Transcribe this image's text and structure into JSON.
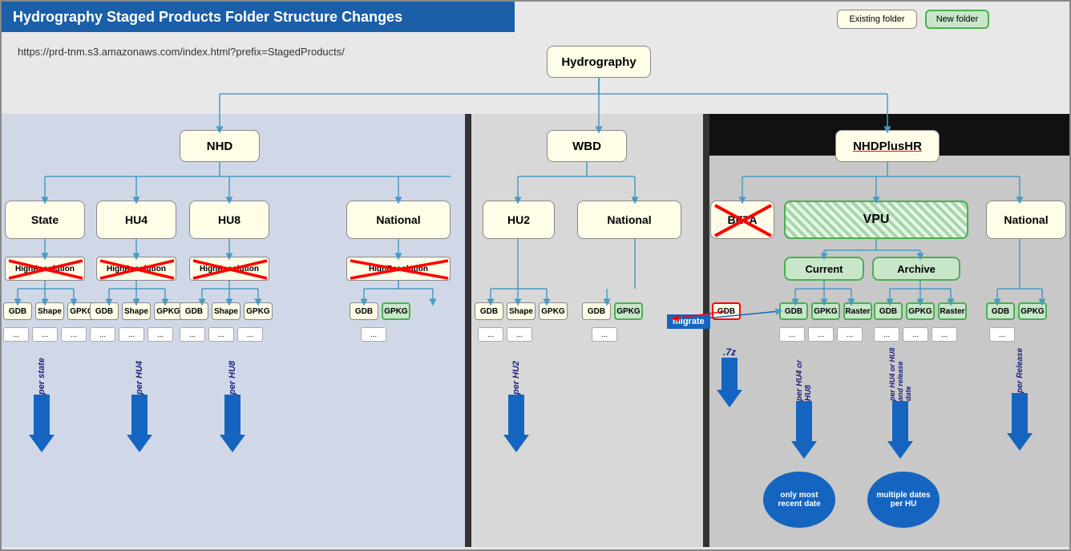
{
  "title": "Hydrography Staged Products Folder Structure Changes",
  "url": "https://prd-tnm.s3.amazonaws.com/index.html?prefix=StagedProducts/",
  "legend": {
    "existing": "Existing folder",
    "new": "New folder"
  },
  "nodes": {
    "hydrography": "Hydrography",
    "nhd": "NHD",
    "wbd": "WBD",
    "nhdplushr": "NHDPlusHR",
    "nhd_children": [
      "State",
      "HU4",
      "HU8",
      "National"
    ],
    "wbd_children": [
      "HU2",
      "National"
    ],
    "nhdplushr_children": [
      "BETA",
      "VPU",
      "National"
    ],
    "vpu_children": [
      "Current",
      "Archive"
    ],
    "highresolution": "HighResolution",
    "current": "Current",
    "archive": "Archive"
  },
  "data_types": {
    "gdb": "GDB",
    "shape": "Shape",
    "gpkg": "GPKG",
    "raster": "Raster",
    "ellipsis": "..."
  },
  "labels": {
    "per_state": "per state",
    "per_hu4": "per HU4",
    "per_hu8": "per HU8",
    "per_hu2": "per HU2",
    "per_hu4_or_hu8": "per HU4 or HU8",
    "and_release_date": "and release date",
    "per_release": "per Release",
    "dot7z": ".7z",
    "migrate": "migrate",
    "only_most_recent_date": "only most recent date",
    "multiple_dates_per_hu": "multiple dates per HU"
  },
  "notes": {
    "note7": "7 only most recent date"
  }
}
